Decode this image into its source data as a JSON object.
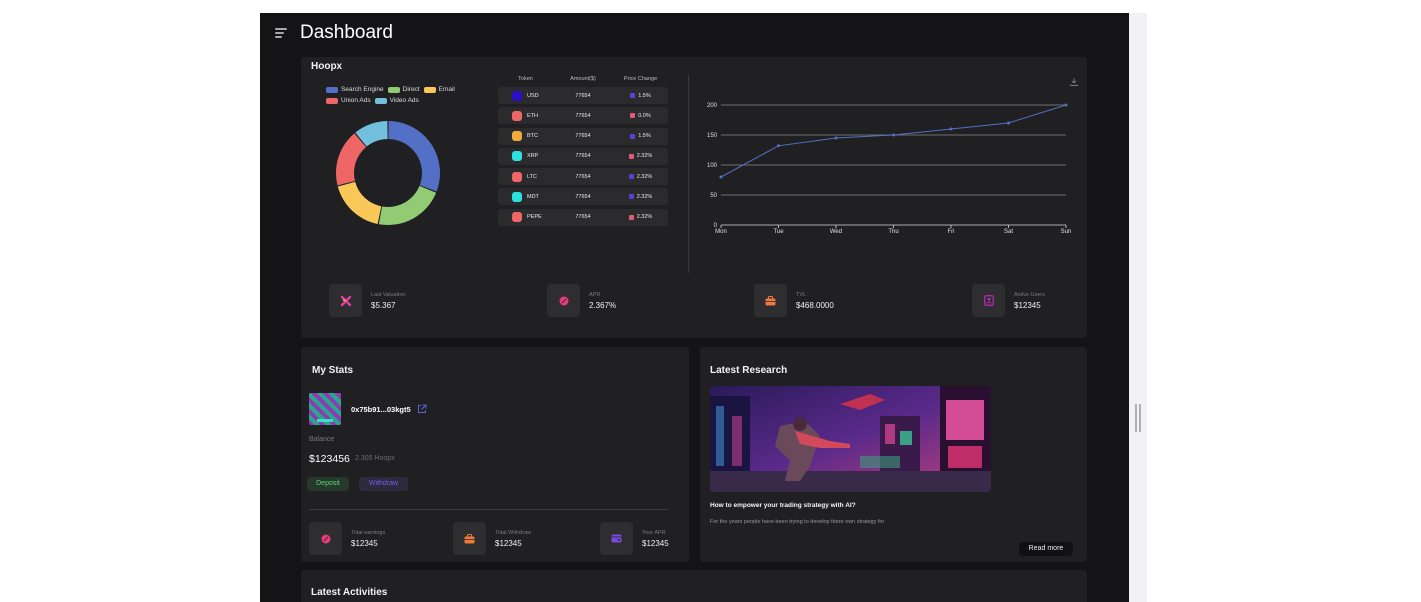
{
  "page": {
    "title": "Dashboard"
  },
  "hoopx": {
    "title": "Hoopx",
    "legend": [
      {
        "label": "Search Engine",
        "color": "#5470c6"
      },
      {
        "label": "Direct",
        "color": "#91cc75"
      },
      {
        "label": "Email",
        "color": "#fac858"
      },
      {
        "label": "Union Ads",
        "color": "#ee6666"
      },
      {
        "label": "Video Ads",
        "color": "#73c0de"
      }
    ],
    "table": {
      "headers": [
        "Token",
        "Amount($)",
        "Price Change"
      ],
      "rows": [
        {
          "token": "USD",
          "amount": "77654",
          "change": "1.5%",
          "icon_color": "#2a10c8",
          "change_color": "#5b3fd6"
        },
        {
          "token": "ETH",
          "amount": "77654",
          "change": "0.0%",
          "icon_color": "#ee6666",
          "change_color": "#e05a7a"
        },
        {
          "token": "BTC",
          "amount": "77654",
          "change": "1.5%",
          "icon_color": "#f5a83a",
          "change_color": "#5b3fd6"
        },
        {
          "token": "XRP",
          "amount": "77654",
          "change": "2.32%",
          "icon_color": "#2ee0e0",
          "change_color": "#e05a7a"
        },
        {
          "token": "LTC",
          "amount": "77654",
          "change": "2.32%",
          "icon_color": "#ee6666",
          "change_color": "#5b3fd6"
        },
        {
          "token": "MDT",
          "amount": "77654",
          "change": "2.32%",
          "icon_color": "#2ee0e0",
          "change_color": "#5b3fd6"
        },
        {
          "token": "PEPE",
          "amount": "77654",
          "change": "2.32%",
          "icon_color": "#ee6666",
          "change_color": "#e05a7a"
        }
      ]
    },
    "stats": [
      {
        "label": "Last Valuation",
        "value": "$5.367",
        "icon": "x-icon",
        "icon_color": "#e040a0"
      },
      {
        "label": "APR",
        "value": "2.367%",
        "icon": "percent-icon",
        "icon_color": "#e83a7c"
      },
      {
        "label": "TVL",
        "value": "$468.0000",
        "icon": "briefcase-icon",
        "icon_color": "#f07a3c"
      },
      {
        "label": "Active Users",
        "value": "$12345",
        "icon": "user-card-icon",
        "icon_color": "#b02ab0"
      }
    ]
  },
  "chart_data": [
    {
      "type": "pie",
      "donut": true,
      "categories": [
        "Search Engine",
        "Direct",
        "Email",
        "Union Ads",
        "Video Ads"
      ],
      "values": [
        31,
        22,
        18,
        18,
        11
      ],
      "colors": [
        "#5470c6",
        "#91cc75",
        "#fac858",
        "#ee6666",
        "#73c0de"
      ],
      "legend": "top-left"
    },
    {
      "type": "line",
      "x": [
        "Mon",
        "Tue",
        "Wed",
        "Thu",
        "Fri",
        "Sat",
        "Sun"
      ],
      "series": [
        {
          "values": [
            80,
            132,
            145,
            150,
            160,
            170,
            200
          ]
        }
      ],
      "ylim": [
        0,
        200
      ],
      "yticks": [
        0,
        50,
        100,
        150,
        200
      ],
      "grid": true,
      "color": "#5470c6"
    }
  ],
  "my_stats": {
    "title": "My Stats",
    "address": "0x75b91...03kgt5",
    "balance_label": "Balance",
    "balance_value": "$123456",
    "balance_sub": "2.305 Hoopx",
    "deposit_label": "Deposit",
    "withdraw_label": "Withdraw",
    "items": [
      {
        "label": "Total earnings",
        "value": "$12345",
        "icon": "percent-icon",
        "icon_color": "#e83a7c"
      },
      {
        "label": "Total Withdraw",
        "value": "$12345",
        "icon": "briefcase-icon",
        "icon_color": "#f07a3c"
      },
      {
        "label": "Your APR",
        "value": "$12345",
        "icon": "card-icon",
        "icon_color": "#7a4ae0"
      }
    ]
  },
  "research": {
    "title": "Latest Research",
    "article_title": "How to empower your trading strategy with AI?",
    "article_desc": "For the years people have been trying to develop there own strategy for",
    "read_more": "Read more"
  },
  "activities": {
    "title": "Latest Activities"
  }
}
